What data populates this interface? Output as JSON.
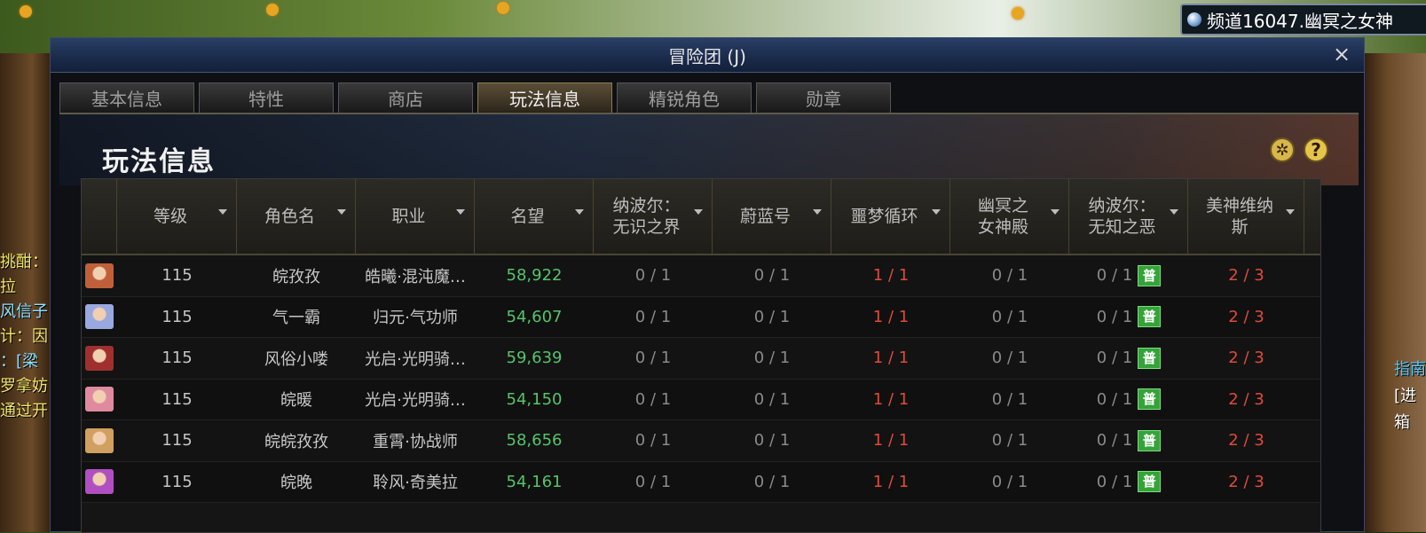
{
  "background": {
    "channel": "频道16047.幽冥之女神",
    "left_chat": [
      "挑酣：",
      "拉",
      "风信子",
      "计：因",
      "：[梁",
      "罗拿妨",
      "",
      "通过开"
    ],
    "right_side": [
      "指南",
      "[进",
      "",
      "箱"
    ]
  },
  "window": {
    "title": "冒险团 (J)",
    "close_label": "×",
    "tabs": [
      {
        "label": "基本信息",
        "active": false
      },
      {
        "label": "特性",
        "active": false
      },
      {
        "label": "商店",
        "active": false
      },
      {
        "label": "玩法信息",
        "active": true
      },
      {
        "label": "精锐角色",
        "active": false
      },
      {
        "label": "勋章",
        "active": false
      }
    ],
    "section_title": "玩法信息",
    "settings_icon": "gear-icon",
    "help_icon": "help-icon",
    "help_label": "?"
  },
  "table": {
    "columns": [
      "",
      "等级",
      "角色名",
      "职业",
      "名望",
      "纳波尔：\n无识之界",
      "蔚蓝号",
      "噩梦循环",
      "幽冥之\n女神殿",
      "纳波尔：\n无知之恶",
      "美神维纳\n斯"
    ],
    "tag_label": "普",
    "colors": {
      "fame": "#55c46a",
      "cleared": "#e04a3a",
      "pending": "#8a8a8a",
      "tag": "#36a33a"
    },
    "rows": [
      {
        "avatar": "#c0603a",
        "level": "115",
        "name": "皖孜孜",
        "job": "皓曦·混沌魔…",
        "fame": "58,922",
        "c1": "0 / 1",
        "c2": "0 / 1",
        "c3": "1 / 1",
        "c4": "0 / 1",
        "c5": "0 / 1",
        "c6": "2 / 3"
      },
      {
        "avatar": "#9aa8e0",
        "level": "115",
        "name": "气一霸",
        "job": "归元·气功师",
        "fame": "54,607",
        "c1": "0 / 1",
        "c2": "0 / 1",
        "c3": "1 / 1",
        "c4": "0 / 1",
        "c5": "0 / 1",
        "c6": "2 / 3"
      },
      {
        "avatar": "#a03030",
        "level": "115",
        "name": "风俗小喽",
        "job": "光启·光明骑…",
        "fame": "59,639",
        "c1": "0 / 1",
        "c2": "0 / 1",
        "c3": "1 / 1",
        "c4": "0 / 1",
        "c5": "0 / 1",
        "c6": "2 / 3"
      },
      {
        "avatar": "#e08aa0",
        "level": "115",
        "name": "皖暖",
        "job": "光启·光明骑…",
        "fame": "54,150",
        "c1": "0 / 1",
        "c2": "0 / 1",
        "c3": "1 / 1",
        "c4": "0 / 1",
        "c5": "0 / 1",
        "c6": "2 / 3"
      },
      {
        "avatar": "#d0a060",
        "level": "115",
        "name": "皖皖孜孜",
        "job": "重霄·协战师",
        "fame": "58,656",
        "c1": "0 / 1",
        "c2": "0 / 1",
        "c3": "1 / 1",
        "c4": "0 / 1",
        "c5": "0 / 1",
        "c6": "2 / 3"
      },
      {
        "avatar": "#b050c0",
        "level": "115",
        "name": "皖晚",
        "job": "聆风·奇美拉",
        "fame": "54,161",
        "c1": "0 / 1",
        "c2": "0 / 1",
        "c3": "1 / 1",
        "c4": "0 / 1",
        "c5": "0 / 1",
        "c6": "2 / 3"
      }
    ]
  }
}
